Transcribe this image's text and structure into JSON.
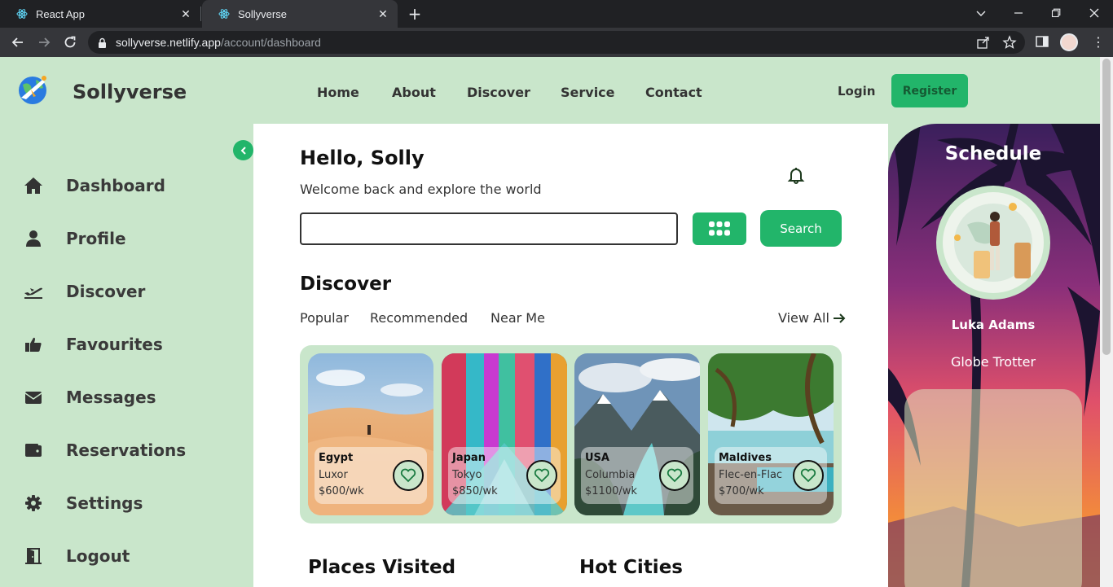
{
  "browser": {
    "tabs": [
      {
        "title": "React App"
      },
      {
        "title": "Sollyverse"
      }
    ],
    "url_host": "sollyverse.netlify.app",
    "url_path": "/account/dashboard"
  },
  "header": {
    "brand": "Sollyverse",
    "nav": [
      "Home",
      "About",
      "Discover",
      "Service",
      "Contact"
    ],
    "login_label": "Login",
    "register_label": "Register"
  },
  "sidebar": {
    "items": [
      {
        "label": "Dashboard",
        "icon": "home-icon"
      },
      {
        "label": "Profile",
        "icon": "user-icon"
      },
      {
        "label": "Discover",
        "icon": "plane-takeoff-icon"
      },
      {
        "label": "Favourites",
        "icon": "thumbs-up-icon"
      },
      {
        "label": "Messages",
        "icon": "envelope-icon"
      },
      {
        "label": "Reservations",
        "icon": "wallet-icon"
      },
      {
        "label": "Settings",
        "icon": "gear-icon"
      },
      {
        "label": "Logout",
        "icon": "door-exit-icon"
      }
    ]
  },
  "main": {
    "greeting": "Hello, Solly",
    "subtitle": "Welcome back and explore the world",
    "search": {
      "value": "",
      "button_label": "Search"
    },
    "discover_title": "Discover",
    "filters": [
      "Popular",
      "Recommended",
      "Near Me"
    ],
    "view_all": "View All",
    "cards": [
      {
        "country": "Egypt",
        "city": "Luxor",
        "price": "$600/wk"
      },
      {
        "country": "Japan",
        "city": "Tokyo",
        "price": "$850/wk"
      },
      {
        "country": "USA",
        "city": "Columbia",
        "price": "$1100/wk"
      },
      {
        "country": "Maldives",
        "city": "Flec-en-Flac",
        "price": "$700/wk"
      }
    ],
    "places_visited": "Places Visited",
    "hot_cities": "Hot Cities"
  },
  "schedule": {
    "title": "Schedule",
    "user_name": "Luka Adams",
    "user_role": "Globe Trotter"
  },
  "colors": {
    "accent": "#22b56a",
    "background": "#c9e6cb",
    "chrome_dark": "#202124"
  }
}
